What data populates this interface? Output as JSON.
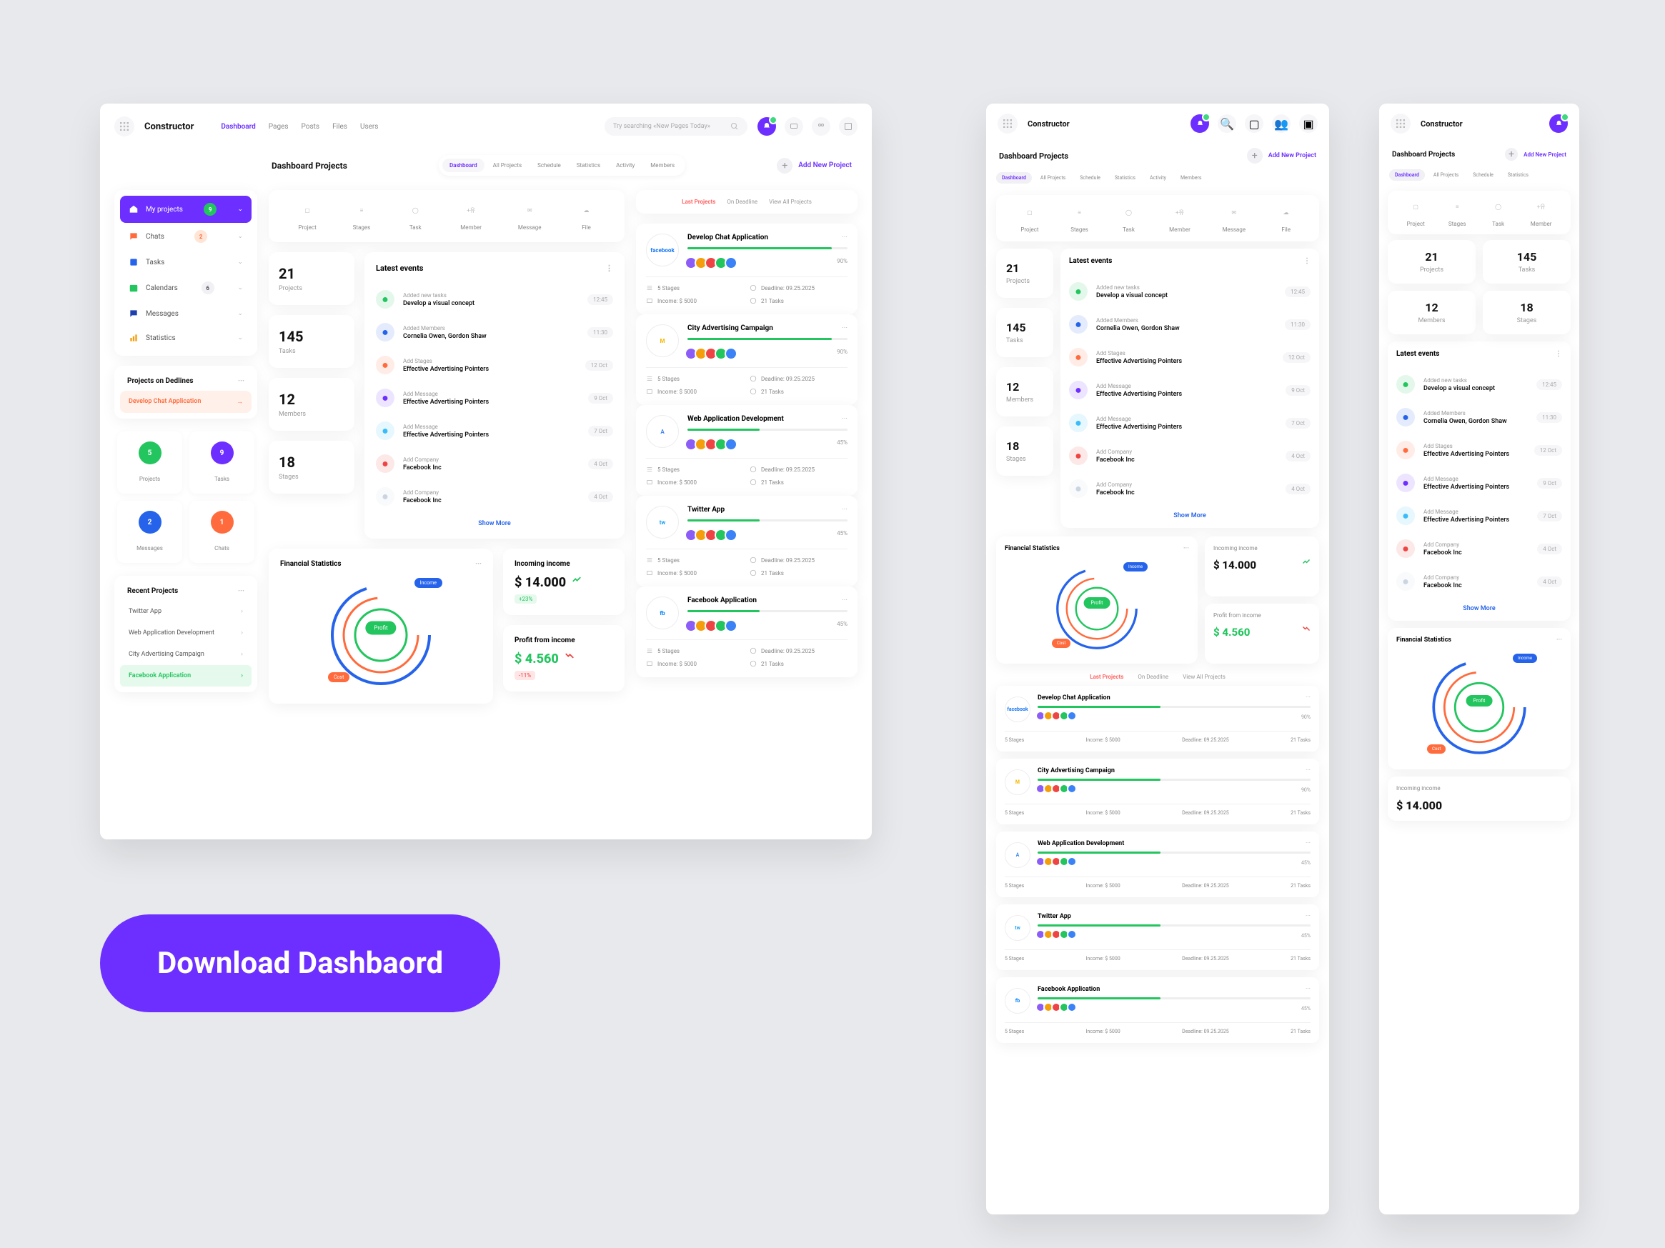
{
  "brand": "Constructor",
  "nav": [
    "Dashboard",
    "Pages",
    "Posts",
    "Files",
    "Users"
  ],
  "search_ph": "Try searching «New Pages Today»",
  "section_title": "Dashboard Projects",
  "sec_tabs": [
    "Dashboard",
    "All Projects",
    "Schedule",
    "Statistics",
    "Activity",
    "Members"
  ],
  "add_new": "Add New Project",
  "sidebar": {
    "items": [
      {
        "label": "My projects",
        "badge": "9"
      },
      {
        "label": "Chats",
        "badge": "2"
      },
      {
        "label": "Tasks"
      },
      {
        "label": "Calendars",
        "badge": "6"
      },
      {
        "label": "Messages"
      },
      {
        "label": "Statistics"
      }
    ],
    "deadlines_title": "Projects on Dedlines",
    "dev_chat": "Develop Chat Application",
    "boxes": [
      {
        "n": "5",
        "label": "Projects",
        "c": "#22c55e"
      },
      {
        "n": "9",
        "label": "Tasks",
        "c": "#6d2fff"
      },
      {
        "n": "2",
        "label": "Messages",
        "c": "#2563eb"
      },
      {
        "n": "1",
        "label": "Chats",
        "c": "#ff6b3d"
      }
    ],
    "recent_title": "Recent Projects",
    "recent": [
      "Twitter App",
      "Web Application Development",
      "City Advertising Campaign",
      "Facebook Application"
    ]
  },
  "tools": [
    "Project",
    "Stages",
    "Task",
    "Member",
    "Message",
    "File"
  ],
  "stats": [
    {
      "n": "21",
      "l": "Projects"
    },
    {
      "n": "145",
      "l": "Tasks"
    },
    {
      "n": "12",
      "l": "Members"
    },
    {
      "n": "18",
      "l": "Stages"
    }
  ],
  "events": {
    "title": "Latest events",
    "rows": [
      {
        "l1": "Added new tasks",
        "l2": "Develop a visual concept",
        "t": "12:45",
        "c": "#22c55e"
      },
      {
        "l1": "Added Members",
        "l2": "Cornelia Owen, Gordon Shaw",
        "t": "11:30",
        "c": "#2563eb"
      },
      {
        "l1": "Add Stages",
        "l2": "Effective Advertising Pointers",
        "t": "12 Oct",
        "c": "#ff6b3d"
      },
      {
        "l1": "Add Message",
        "l2": "Effective Advertising Pointers",
        "t": "9 Oct",
        "c": "#6d2fff"
      },
      {
        "l1": "Add Message",
        "l2": "Effective Advertising Pointers",
        "t": "7 Oct",
        "c": "#38bdf8"
      },
      {
        "l1": "Add Company",
        "l2": "Facebook Inc",
        "t": "4 Oct",
        "c": "#ef4444"
      },
      {
        "l1": "Add Company",
        "l2": "Facebook Inc",
        "t": "4 Oct",
        "c": "#cbd5e1"
      }
    ],
    "more": "Show More"
  },
  "finance": {
    "title": "Financial Statistics",
    "chips": [
      "Income",
      "Profit",
      "Cost"
    ],
    "incoming_title": "Incoming income",
    "incoming": "$ 14.000",
    "incoming_pct": "+23%",
    "profit_title": "Profit from income",
    "profit": "$ 4.560",
    "profit_pct": "-11%"
  },
  "rtabs": [
    "Last Projects",
    "On Deadline",
    "View All Projects"
  ],
  "projects": [
    {
      "ic": "facebook",
      "icc": "#1877f2",
      "t": "Develop Chat Application",
      "pct": "90%",
      "w": "90%",
      "stages": "5 Stages",
      "deadline": "Deadline: 09.25.2025",
      "income": "Income: $ 5000",
      "tasks": "21 Tasks"
    },
    {
      "ic": "M",
      "icc": "#f5b800",
      "t": "City Advertising Campaign",
      "pct": "90%",
      "w": "90%",
      "stages": "5 Stages",
      "deadline": "Deadline: 09.25.2025",
      "income": "Income: $ 5000",
      "tasks": "21 Tasks"
    },
    {
      "ic": "A",
      "icc": "#4285f4",
      "t": "Web Application Development",
      "pct": "45%",
      "w": "45%",
      "stages": "5 Stages",
      "deadline": "Deadline: 09.25.2025",
      "income": "Income: $ 5000",
      "tasks": "21 Tasks"
    },
    {
      "ic": "tw",
      "icc": "#1da1f2",
      "t": "Twitter App",
      "pct": "45%",
      "w": "45%",
      "stages": "5 Stages",
      "deadline": "Deadline: 09.25.2025",
      "income": "Income: $ 5000",
      "tasks": "21 Tasks"
    },
    {
      "ic": "fb",
      "icc": "#0084ff",
      "t": "Facebook Application",
      "pct": "45%",
      "w": "45%",
      "stages": "5 Stages",
      "deadline": "Deadline: 09.25.2025",
      "income": "Income: $ 5000",
      "tasks": "21 Tasks"
    }
  ],
  "download": "Download Dashbaord",
  "avatar_colors": [
    "#8b5cf6",
    "#f59e0b",
    "#ef4444",
    "#22c55e",
    "#3b82f6"
  ]
}
